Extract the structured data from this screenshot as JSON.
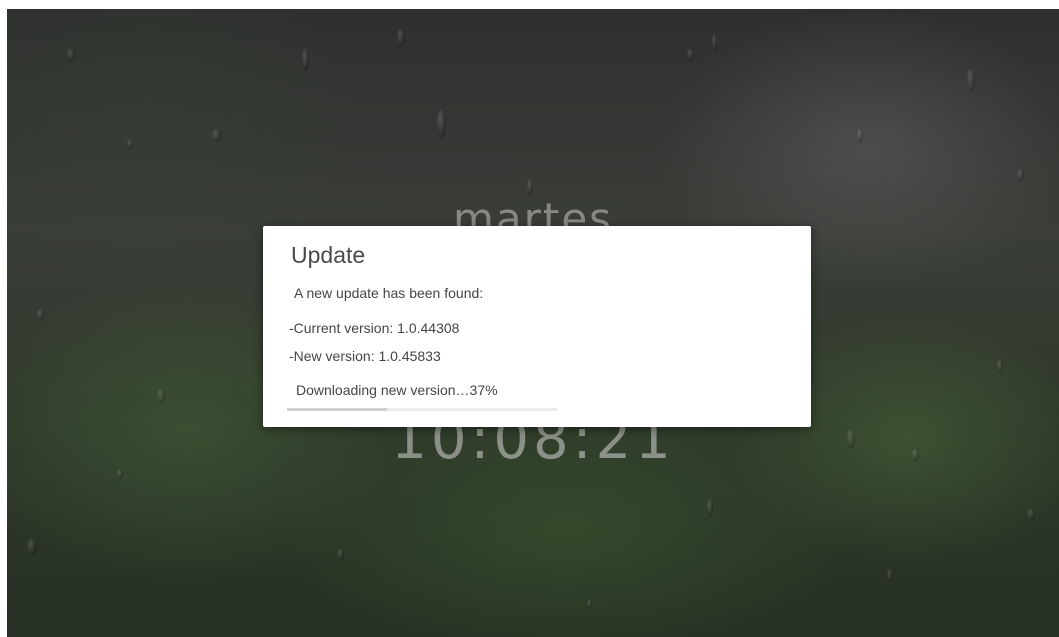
{
  "lockscreen": {
    "day": "martes",
    "time": "10:08:21"
  },
  "dialog": {
    "title": "Update",
    "message": "A new update has been found:",
    "current_version": "-Current version: 1.0.44308",
    "new_version": "-New version: 1.0.45833",
    "status": "Downloading new version…37%",
    "progress_percent": 37
  },
  "colors": {
    "dialog_background": "#ffffff",
    "dialog_text": "#444444"
  }
}
